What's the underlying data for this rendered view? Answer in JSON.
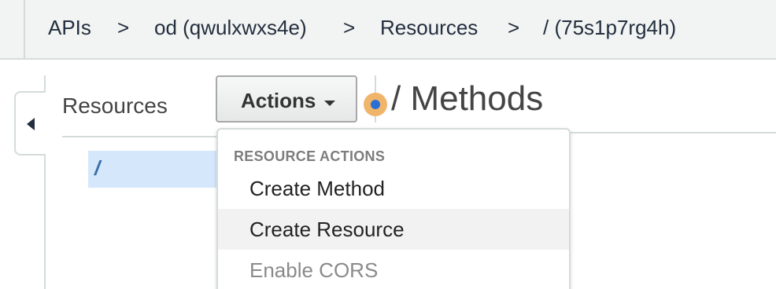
{
  "breadcrumb": {
    "items": [
      "APIs",
      "od (qwulxwxs4e)",
      "Resources",
      "/ (75s1p7rg4h)"
    ],
    "separator": ">"
  },
  "sidebar": {
    "title": "Resources",
    "tree": [
      {
        "label": "/",
        "selected": true
      }
    ]
  },
  "toolbar": {
    "actions_label": "Actions"
  },
  "main": {
    "title": "/ Methods"
  },
  "dropdown": {
    "section_label": "RESOURCE ACTIONS",
    "items": [
      {
        "label": "Create Method",
        "state": "normal"
      },
      {
        "label": "Create Resource",
        "state": "hover"
      },
      {
        "label": "Enable CORS",
        "state": "disabled"
      }
    ]
  },
  "colors": {
    "breadcrumb_bg": "#f2f3f3",
    "selected_bg": "#d5e7fb",
    "selected_text": "#3a6ea8",
    "status_outer": "#f0b56a",
    "status_inner": "#2a6fd6",
    "disabled_text": "#8a8a8a"
  }
}
